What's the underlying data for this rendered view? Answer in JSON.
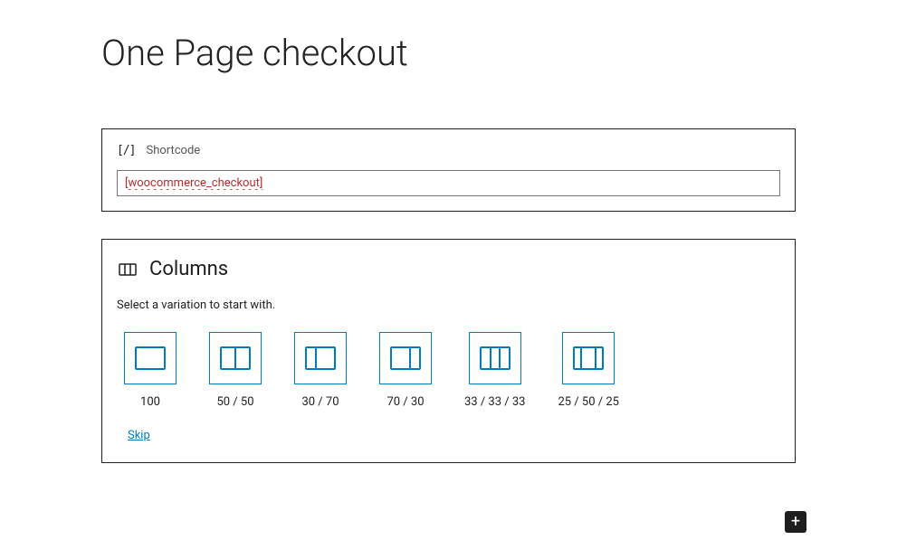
{
  "page_title": "One Page checkout",
  "shortcode_block": {
    "label": "Shortcode",
    "icon_text": "[/]",
    "value": "[woocommerce_checkout]"
  },
  "columns_block": {
    "title": "Columns",
    "description": "Select a variation to start with.",
    "skip_label": "Skip",
    "variations": [
      {
        "label": "100"
      },
      {
        "label": "50 / 50"
      },
      {
        "label": "30 / 70"
      },
      {
        "label": "70 / 30"
      },
      {
        "label": "33 / 33 / 33"
      },
      {
        "label": "25 / 50 / 25"
      }
    ]
  },
  "add_button": {
    "symbol": "+"
  }
}
